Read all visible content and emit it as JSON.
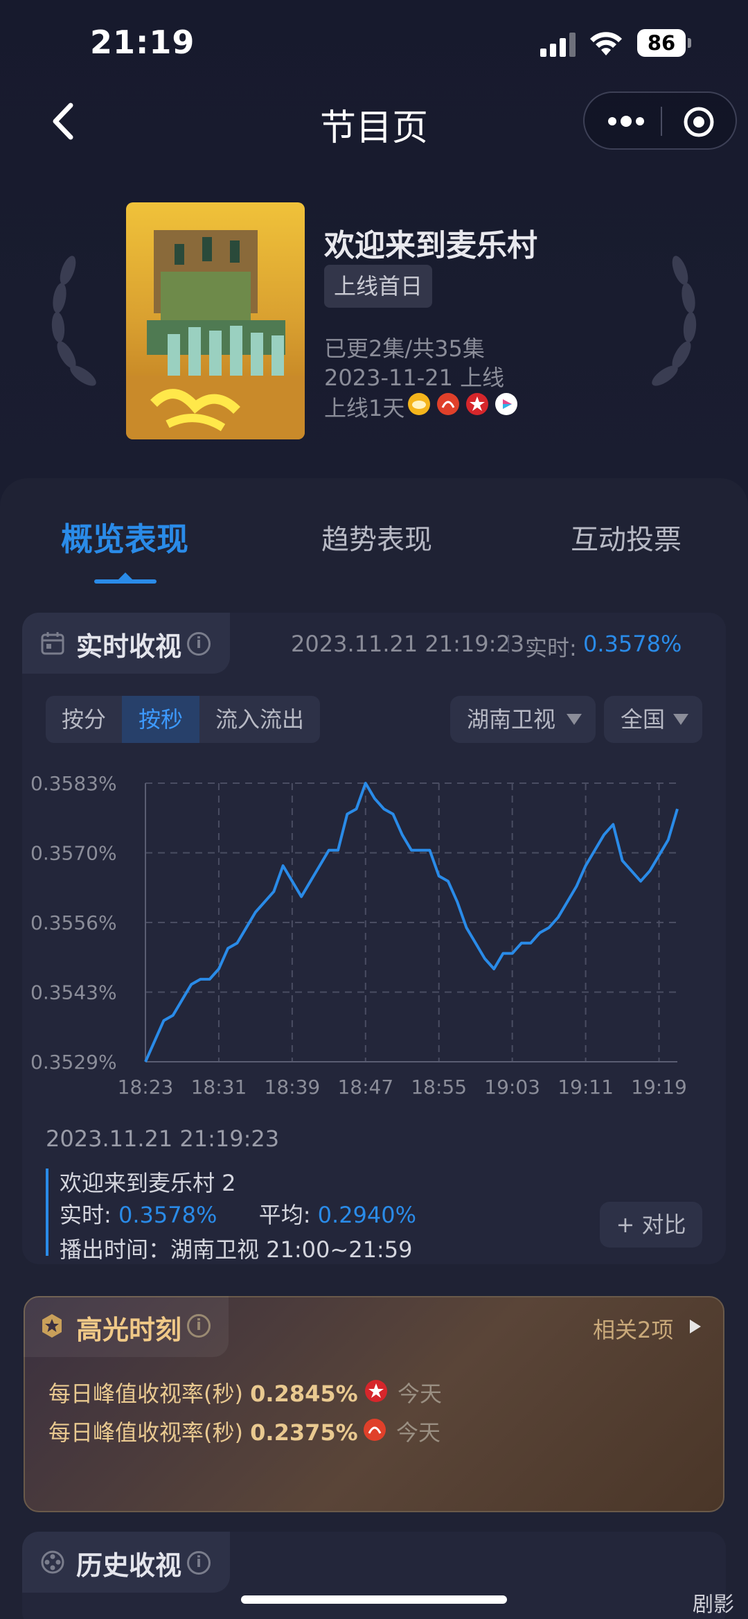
{
  "status": {
    "time": "21:19",
    "battery": "86"
  },
  "nav": {
    "title": "节目页"
  },
  "show": {
    "title": "欢迎来到麦乐村",
    "tag": "上线首日",
    "episodes": "已更2集/共35集",
    "release": "2023-11-21 上线",
    "online_days": "上线1天"
  },
  "tabs": [
    {
      "label": "概览表现",
      "active": true
    },
    {
      "label": "趋势表现",
      "active": false
    },
    {
      "label": "互动投票",
      "active": false
    }
  ],
  "realtime": {
    "title": "实时收视",
    "timestamp": "2023.11.21 21:19:23",
    "label": "实时:",
    "value": "0.3578%",
    "segments": [
      "按分",
      "按秒",
      "流入流出"
    ],
    "active_segment": "按秒",
    "channel": "湖南卫视",
    "region": "全国"
  },
  "chart_data": {
    "type": "line",
    "title": "",
    "xlabel": "",
    "ylabel": "",
    "x_ticks": [
      "18:23",
      "18:31",
      "18:39",
      "18:47",
      "18:55",
      "19:03",
      "19:11",
      "19:19"
    ],
    "y_ticks": [
      "0.3529%",
      "0.3543%",
      "0.3556%",
      "0.3570%",
      "0.3583%"
    ],
    "ylim": [
      0.3529,
      0.3583
    ],
    "grid": true,
    "series": [
      {
        "color": "#2a8be8",
        "x": [
          "18:23",
          "18:24",
          "18:25",
          "18:26",
          "18:27",
          "18:28",
          "18:29",
          "18:30",
          "18:31",
          "18:32",
          "18:33",
          "18:34",
          "18:35",
          "18:36",
          "18:37",
          "18:38",
          "18:39",
          "18:40",
          "18:41",
          "18:42",
          "18:43",
          "18:44",
          "18:45",
          "18:46",
          "18:47",
          "18:48",
          "18:49",
          "18:50",
          "18:51",
          "18:52",
          "18:53",
          "18:54",
          "18:55",
          "18:56",
          "18:57",
          "18:58",
          "18:59",
          "19:00",
          "19:01",
          "19:02",
          "19:03",
          "19:04",
          "19:05",
          "19:06",
          "19:07",
          "19:08",
          "19:09",
          "19:10",
          "19:11",
          "19:12",
          "19:13",
          "19:14",
          "19:15",
          "19:16",
          "19:17",
          "19:18",
          "19:19",
          "19:20",
          "19:21"
        ],
        "values": [
          0.3529,
          0.3533,
          0.3537,
          0.3538,
          0.3541,
          0.3544,
          0.3545,
          0.3545,
          0.3547,
          0.3551,
          0.3552,
          0.3555,
          0.3558,
          0.356,
          0.3562,
          0.3567,
          0.3564,
          0.3561,
          0.3564,
          0.3567,
          0.357,
          0.357,
          0.3577,
          0.3578,
          0.3583,
          0.358,
          0.3578,
          0.3577,
          0.3573,
          0.357,
          0.357,
          0.357,
          0.3565,
          0.3564,
          0.356,
          0.3555,
          0.3552,
          0.3549,
          0.3547,
          0.355,
          0.355,
          0.3552,
          0.3552,
          0.3554,
          0.3555,
          0.3557,
          0.356,
          0.3563,
          0.3567,
          0.357,
          0.3573,
          0.3575,
          0.3568,
          0.3566,
          0.3564,
          0.3566,
          0.3569,
          0.3572,
          0.3578
        ]
      }
    ]
  },
  "detail": {
    "timestamp": "2023.11.21 21:19:23",
    "title": "欢迎来到麦乐村 2",
    "realtime_label": "实时:",
    "realtime_value": "0.3578%",
    "avg_label": "平均:",
    "avg_value": "0.2940%",
    "airtime": "播出时间：湖南卫视 21:00~21:59",
    "compare": "+ 对比"
  },
  "highlight": {
    "title": "高光时刻",
    "related": "相关2项",
    "rows": [
      {
        "label": "每日峰值收视率(秒)",
        "value": "0.2845%",
        "when": "今天",
        "icon_color": "#d6262b"
      },
      {
        "label": "每日峰值收视率(秒)",
        "value": "0.2375%",
        "when": "今天",
        "icon_color": "#e0402a"
      }
    ]
  },
  "history": {
    "title": "历史收视"
  },
  "watermark": "剧影",
  "colors": {
    "accent": "#2a8be8",
    "gold": "#f0c987"
  }
}
